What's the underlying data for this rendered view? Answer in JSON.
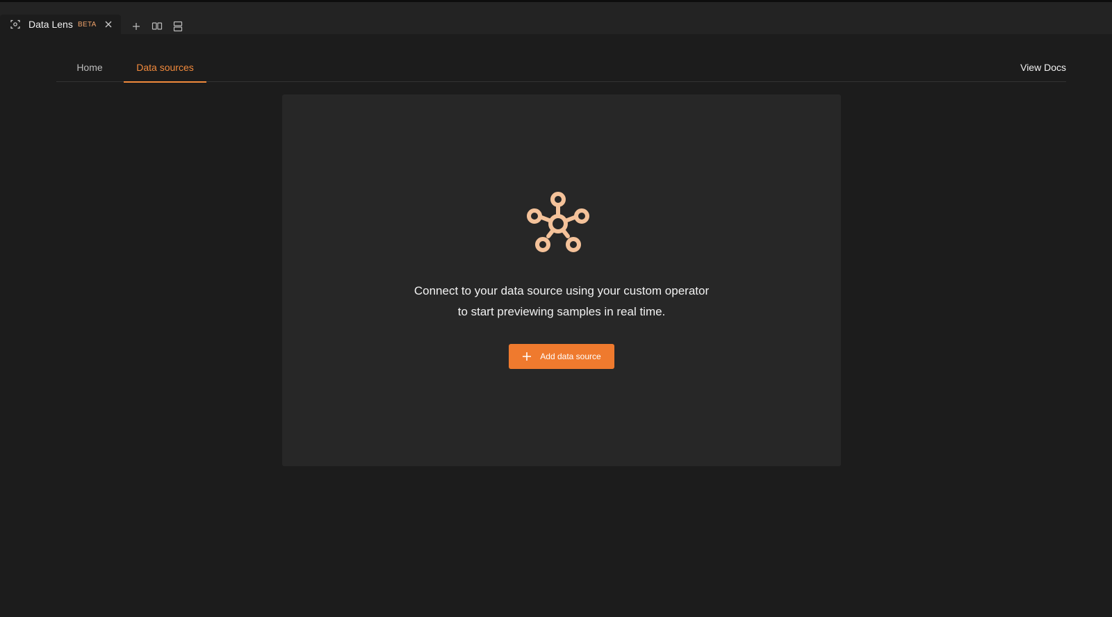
{
  "tab": {
    "title": "Data Lens",
    "badge": "BETA",
    "icon": "target-scan-icon",
    "close_icon": "close-icon"
  },
  "toolbar": {
    "new_tab_icon": "plus-icon",
    "split_vertical_icon": "split-vertical-icon",
    "split_horizontal_icon": "split-horizontal-icon"
  },
  "nav": {
    "tabs": [
      {
        "label": "Home",
        "active": false
      },
      {
        "label": "Data sources",
        "active": true
      }
    ],
    "docs_link": "View Docs"
  },
  "empty_state": {
    "icon": "data-hub-icon",
    "line1": "Connect to your data source using your custom operator",
    "line2": "to start previewing samples in real time.",
    "button_label": "Add data source",
    "button_icon": "plus-icon"
  },
  "colors": {
    "accent": "#ef7a2e",
    "icon_tint": "#f4c29a",
    "background": "#1c1c1c",
    "card": "#272727"
  }
}
